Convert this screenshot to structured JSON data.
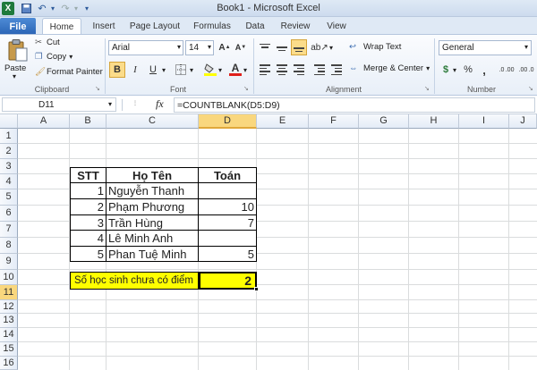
{
  "window": {
    "title": "Book1  -  Microsoft Excel"
  },
  "quick_access": {
    "icons": [
      "excel-logo-icon",
      "save-icon",
      "undo-icon",
      "redo-icon"
    ]
  },
  "tabs": {
    "file": "File",
    "home": "Home",
    "insert": "Insert",
    "page_layout": "Page Layout",
    "formulas": "Formulas",
    "data": "Data",
    "review": "Review",
    "view": "View"
  },
  "ribbon": {
    "clipboard": {
      "paste": "Paste",
      "cut": "Cut",
      "copy": "Copy",
      "copy_caret": "▾",
      "format_painter": "Format Painter",
      "label": "Clipboard"
    },
    "font": {
      "name": "Arial",
      "size": "14",
      "bold": "B",
      "italic": "I",
      "underline": "U",
      "label": "Font"
    },
    "alignment": {
      "wrap_text": "Wrap Text",
      "merge_center": "Merge & Center",
      "merge_caret": "▾",
      "label": "Alignment"
    },
    "number": {
      "format": "General",
      "currency": "$",
      "percent": "%",
      "comma": ",",
      "inc_decimal": ".0 .00",
      "dec_decimal": ".00 .0",
      "label": "Number"
    }
  },
  "formula_bar": {
    "name_box": "D11",
    "fx": "fx",
    "formula": "=COUNTBLANK(D5:D9)"
  },
  "columns": [
    "A",
    "B",
    "C",
    "D",
    "E",
    "F",
    "G",
    "H",
    "I",
    "J"
  ],
  "rows": [
    "1",
    "2",
    "3",
    "4",
    "5",
    "6",
    "7",
    "8",
    "9",
    "10",
    "11",
    "12",
    "13",
    "14",
    "15",
    "16"
  ],
  "table": {
    "headers": {
      "stt": "STT",
      "name": "Họ Tên",
      "math": "Toán"
    },
    "rows": [
      {
        "stt": "1",
        "name": "Nguyễn Thanh",
        "math": ""
      },
      {
        "stt": "2",
        "name": "Phạm Phương",
        "math": "10"
      },
      {
        "stt": "3",
        "name": "Trần Hùng",
        "math": "7"
      },
      {
        "stt": "4",
        "name": "Lê Minh Anh",
        "math": ""
      },
      {
        "stt": "5",
        "name": "Phan Tuệ Minh",
        "math": "5"
      }
    ]
  },
  "summary": {
    "label": "Số học sinh chưa có điểm",
    "value": "2"
  },
  "colors": {
    "highlight": "#ffff00",
    "file_tab": "#2a64b5",
    "selected_header": "#f9d77e"
  }
}
